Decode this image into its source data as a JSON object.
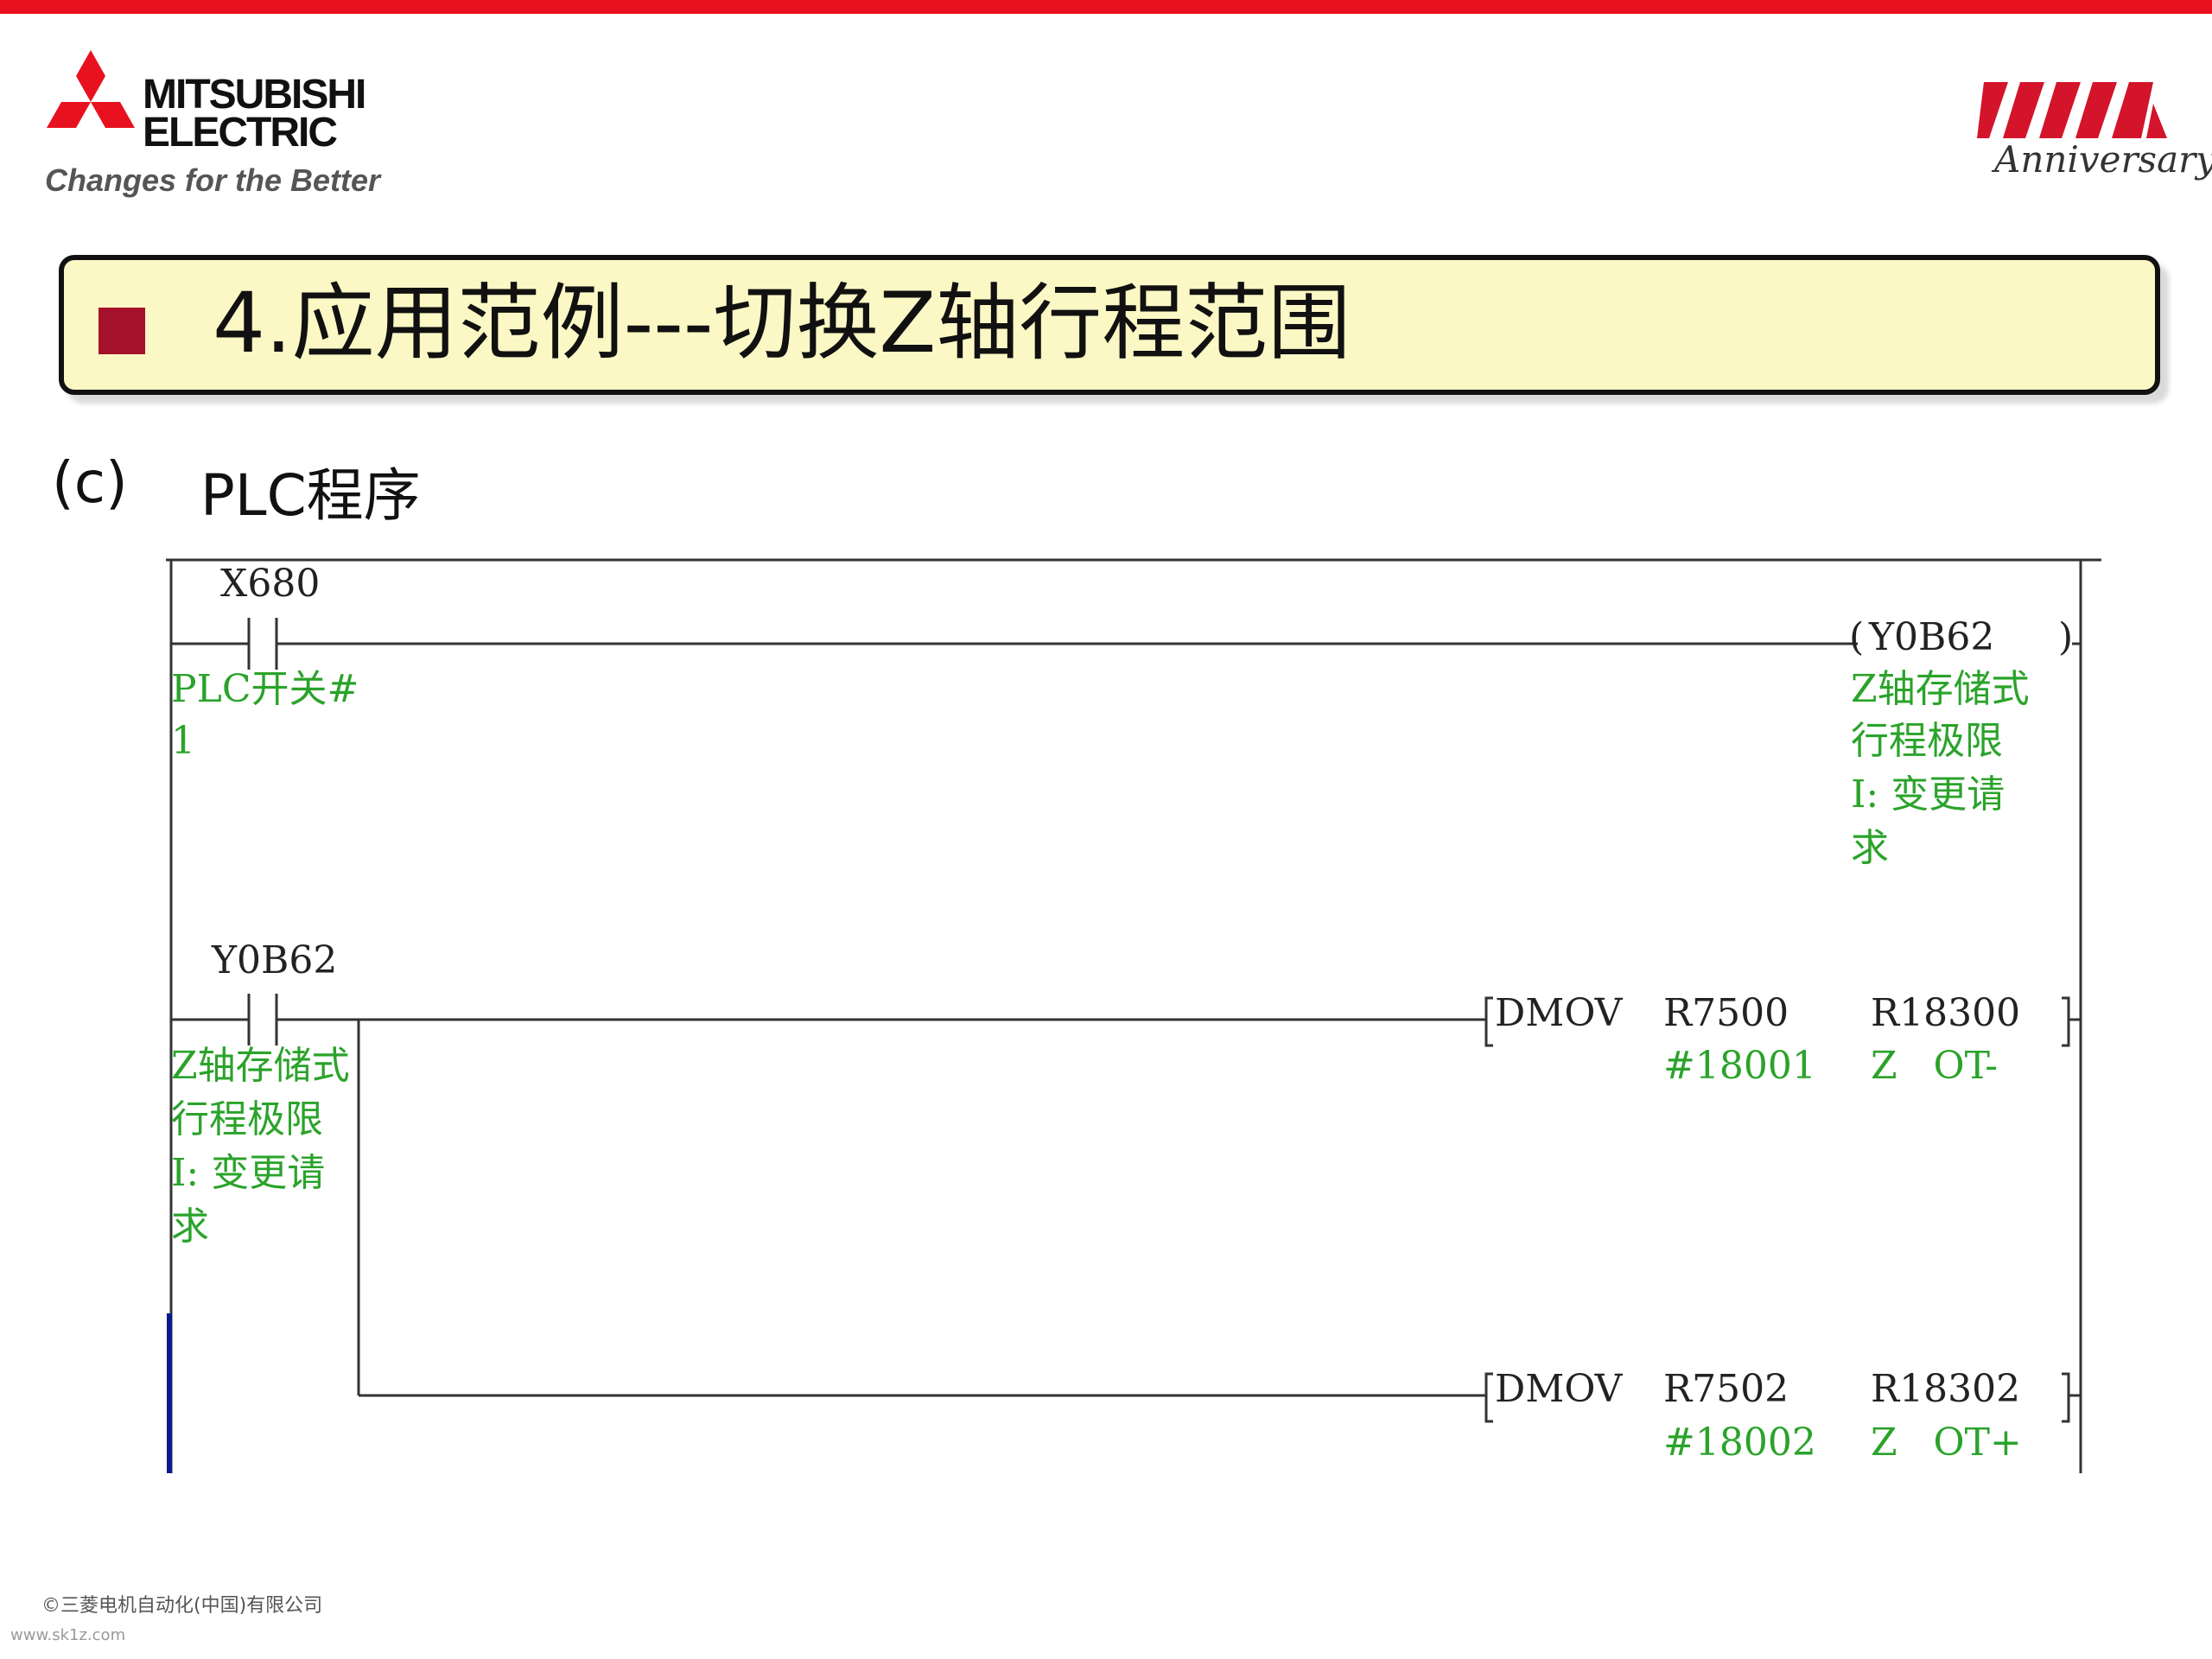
{
  "brand": {
    "name_line1": "MITSUBISHI",
    "name_line2": "ELECTRIC",
    "slogan": "Changes for the Better",
    "anniversary": "Anniversary",
    "colors": {
      "brand_red": "#e8111f",
      "bullet": "#a5102a",
      "title_bg": "#fbf8c5",
      "comment_green": "#2aa32a"
    }
  },
  "slide": {
    "title": "4.应用范例---切换Z轴行程范围",
    "section_label": "(c)",
    "section_title": "PLC程序"
  },
  "ladder": {
    "rung1": {
      "contact": "X680",
      "contact_comment": [
        "PLC开关#",
        "1"
      ],
      "coil": "Y0B62",
      "coil_comment": [
        "Z轴存储式",
        "行程极限",
        "I: 变更请",
        "求"
      ]
    },
    "rung2": {
      "contact": "Y0B62",
      "contact_comment": [
        "Z轴存储式",
        "行程极限",
        "I: 变更请",
        "求"
      ],
      "instr1": {
        "op": "DMOV",
        "src": "R7500",
        "src_comment": "#18001",
        "dst": "R18300",
        "dst_comment": "Z   OT-"
      },
      "instr2": {
        "op": "DMOV",
        "src": "R7502",
        "src_comment": "#18002",
        "dst": "R18302",
        "dst_comment": "Z   OT+"
      }
    }
  },
  "footer": {
    "copyright": "©三菱电机自动化(中国)有限公司",
    "watermark": "www.sk1z.com"
  }
}
